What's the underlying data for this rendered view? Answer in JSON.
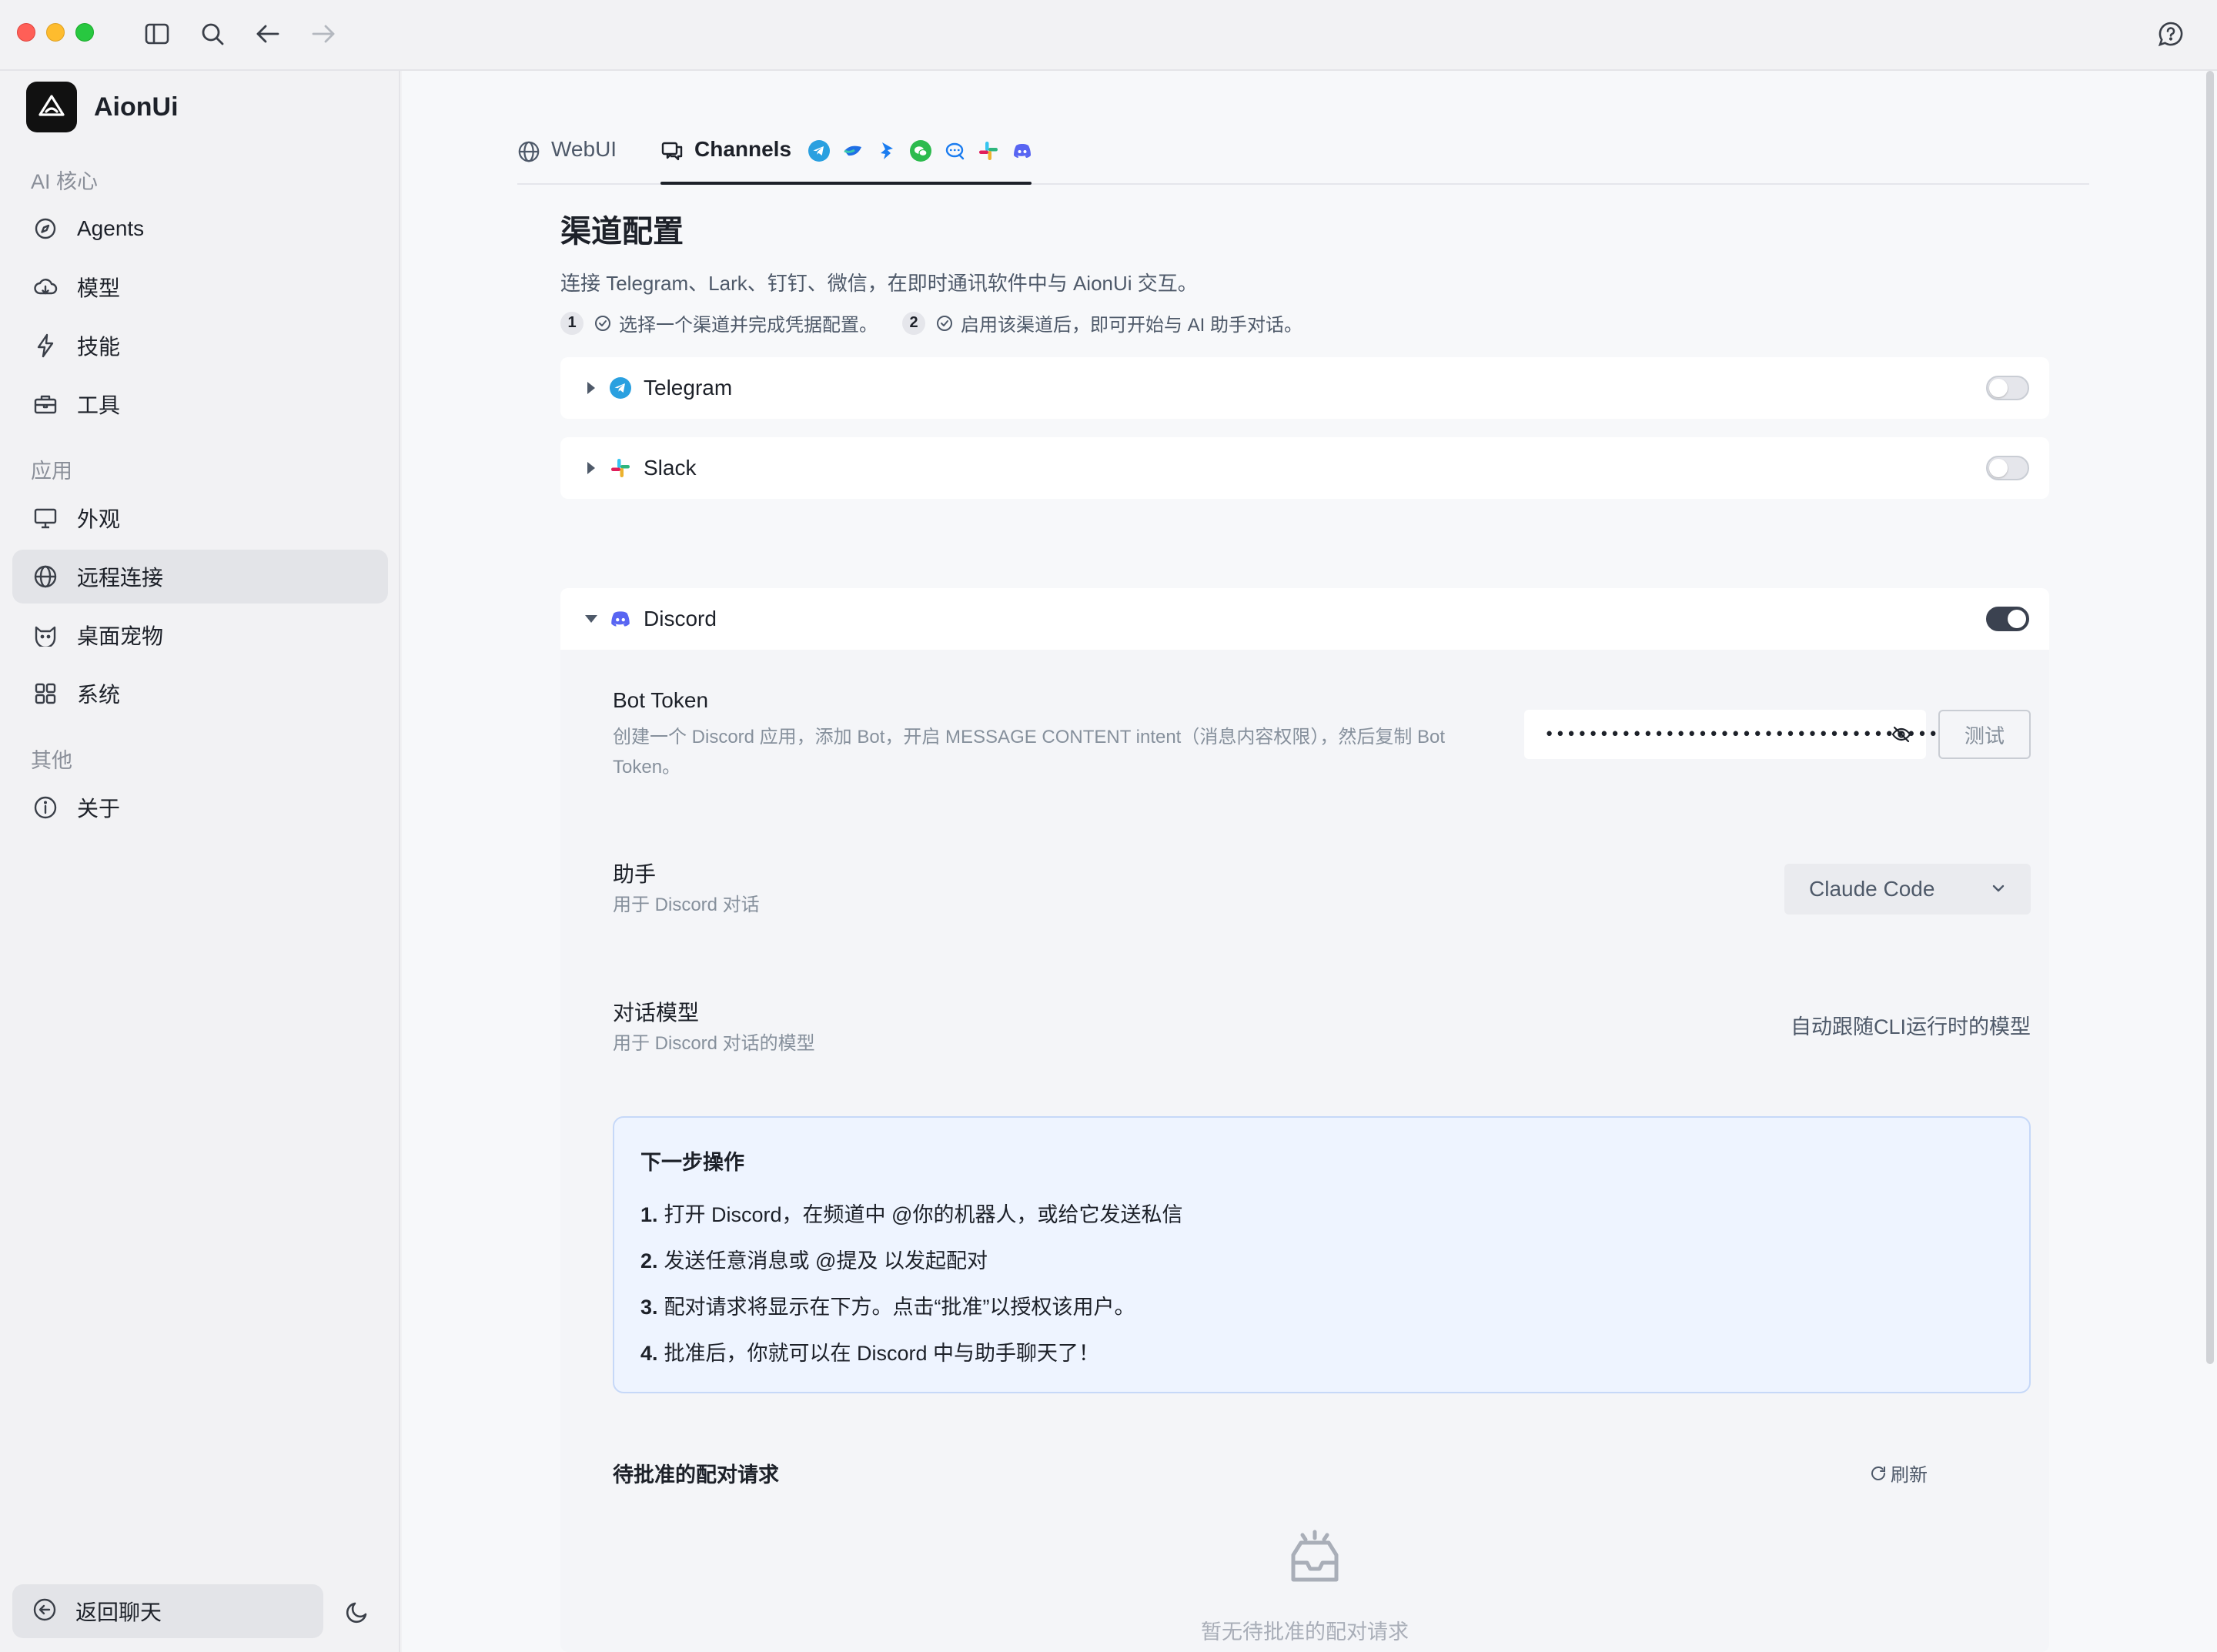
{
  "app": {
    "name": "AionUi"
  },
  "sidebar": {
    "sections": [
      {
        "title": "AI 核心",
        "items": [
          {
            "label": "Agents",
            "icon": "compass-icon"
          },
          {
            "label": "模型",
            "icon": "cloud-icon"
          },
          {
            "label": "技能",
            "icon": "lightning-icon"
          },
          {
            "label": "工具",
            "icon": "toolbox-icon"
          }
        ]
      },
      {
        "title": "应用",
        "items": [
          {
            "label": "外观",
            "icon": "monitor-icon"
          },
          {
            "label": "远程连接",
            "icon": "globe-icon",
            "active": true
          },
          {
            "label": "桌面宠物",
            "icon": "cat-icon"
          },
          {
            "label": "系统",
            "icon": "grid-icon"
          }
        ]
      },
      {
        "title": "其他",
        "items": [
          {
            "label": "关于",
            "icon": "info-icon"
          }
        ]
      }
    ],
    "back_label": "返回聊天"
  },
  "tabs": {
    "webui": "WebUI",
    "channels": "Channels",
    "channel_icons": [
      "telegram-icon",
      "lark-icon",
      "dingtalk-icon",
      "wechat-icon",
      "qq-icon",
      "slack-icon",
      "discord-icon"
    ]
  },
  "page": {
    "title": "渠道配置",
    "desc": "连接 Telegram、Lark、钉钉、微信，在即时通讯软件中与 AionUi 交互。",
    "step1_num": "1",
    "step1_text": "选择一个渠道并完成凭据配置。",
    "step2_num": "2",
    "step2_text": "启用该渠道后，即可开始与 AI 助手对话。"
  },
  "channels": {
    "telegram": {
      "name": "Telegram",
      "enabled": false
    },
    "slack": {
      "name": "Slack",
      "enabled": false
    },
    "discord": {
      "name": "Discord",
      "enabled": true
    }
  },
  "discord": {
    "token_label": "Bot Token",
    "token_desc": "创建一个 Discord 应用，添加 Bot，开启 MESSAGE CONTENT intent（消息内容权限），然后复制 Bot Token。",
    "token_value": "••••••••••••••••••••••••••••••••••••••••",
    "test_label": "测试",
    "assistant_label": "助手",
    "assistant_desc": "用于 Discord 对话",
    "assistant_value": "Claude Code",
    "model_label": "对话模型",
    "model_desc": "用于 Discord 对话的模型",
    "model_value": "自动跟随CLI运行时的模型",
    "next_title": "下一步操作",
    "next_steps": [
      {
        "num": "1.",
        "text": "打开 Discord，在频道中 @你的机器人，或给它发送私信"
      },
      {
        "num": "2.",
        "text": "发送任意消息或 @提及 以发起配对"
      },
      {
        "num": "3.",
        "text": "配对请求将显示在下方。点击“批准”以授权该用户。"
      },
      {
        "num": "4.",
        "text": "批准后，你就可以在 Discord 中与助手聊天了！"
      }
    ],
    "pending_title": "待批准的配对请求",
    "refresh_label": "刷新",
    "empty_text": "暂无待批准的配对请求"
  }
}
